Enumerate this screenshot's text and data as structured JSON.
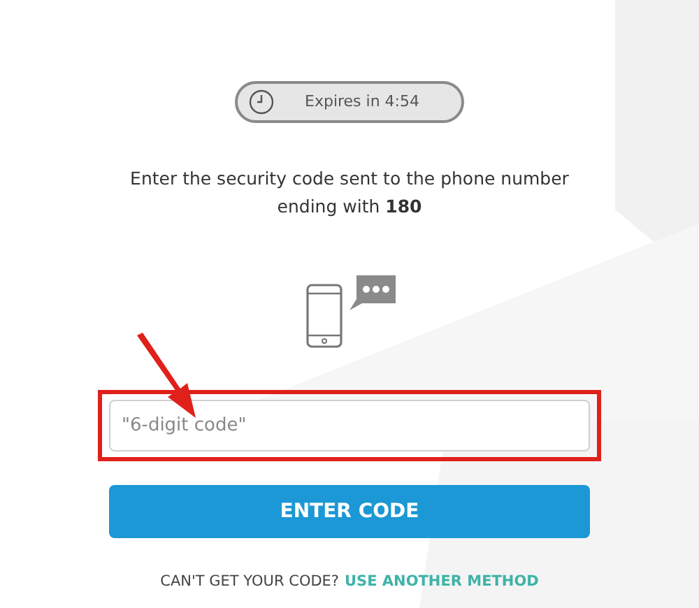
{
  "timer": {
    "text": "Expires in 4:54"
  },
  "instructions": "Enter the security code sent to the phone number ending with **180**",
  "code_field": {
    "placeholder": "\"6-digit code\""
  },
  "submit_button": {
    "label": "ENTER CODE"
  },
  "footer": {
    "question": "CAN'T GET YOUR CODE?",
    "link": "USE ANOTHER METHOD"
  }
}
